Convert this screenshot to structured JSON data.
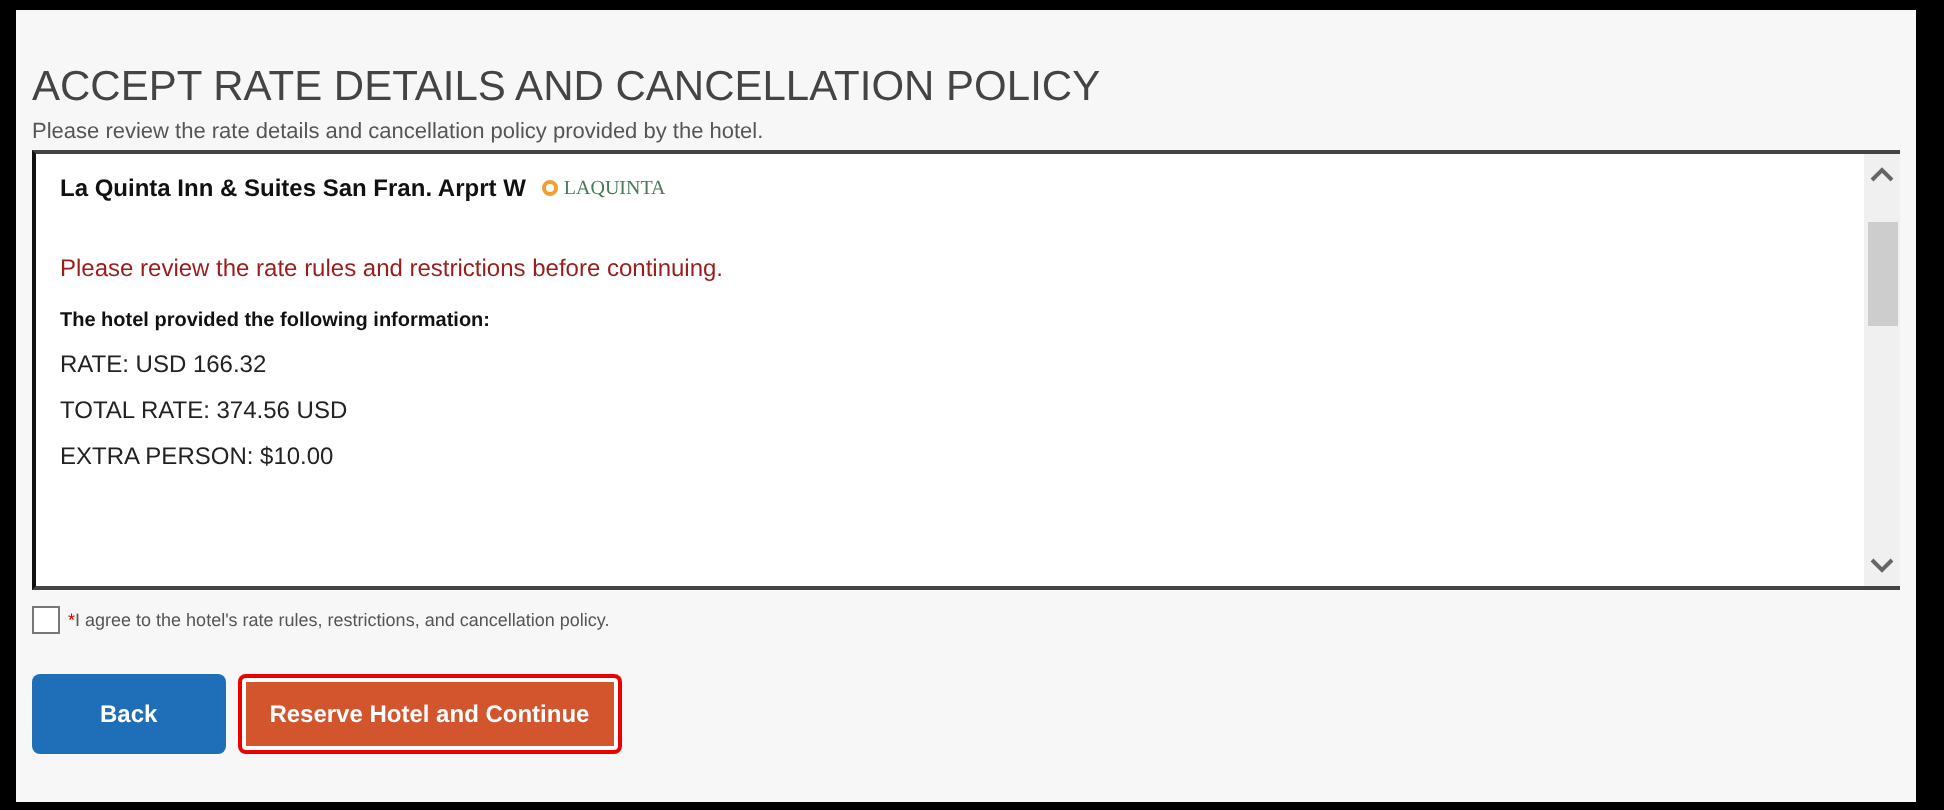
{
  "title": "ACCEPT RATE DETAILS AND CANCELLATION POLICY",
  "subtitle": "Please review the rate details and cancellation policy provided by the hotel.",
  "details": {
    "hotel_name": "La Quinta Inn & Suites San Fran. Arprt W",
    "logo_text": "LAQUINTA",
    "warning": "Please review the rate rules and restrictions before continuing.",
    "info_heading": "The hotel provided the following information:",
    "lines": [
      "RATE: USD 166.32",
      "TOTAL RATE: 374.56 USD",
      "EXTRA PERSON: $10.00"
    ]
  },
  "agreement": {
    "required_mark": "*",
    "label": "I agree to the hotel's rate rules, restrictions, and cancellation policy.",
    "checked": false
  },
  "buttons": [
    {
      "kind": "secondary",
      "label": "Back",
      "highlighted": false
    },
    {
      "kind": "primary",
      "label": "Reserve Hotel and Continue",
      "highlighted": true
    }
  ]
}
